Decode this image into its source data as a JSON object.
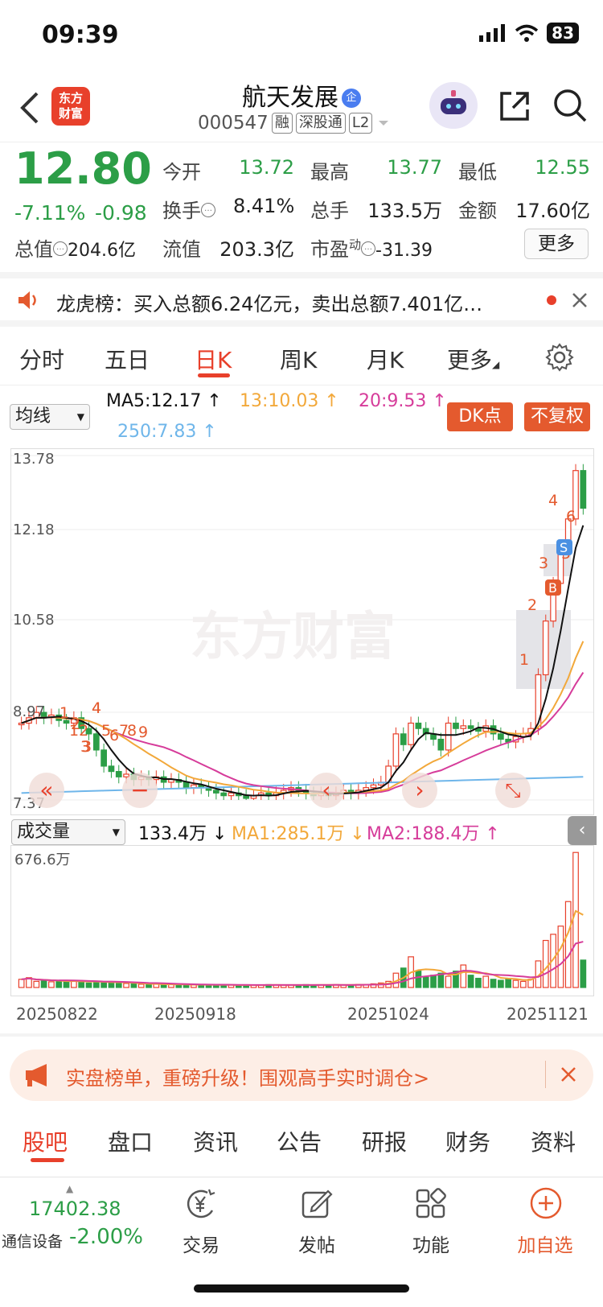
{
  "status_bar": {
    "time": "09:39",
    "battery": "83"
  },
  "header": {
    "logo_line1": "东方",
    "logo_line2": "财富",
    "stock_name": "航天发展",
    "badge": "企",
    "code": "000547",
    "tags": [
      "融",
      "深股通",
      "L2"
    ]
  },
  "quote": {
    "price": "12.80",
    "change_pct": "-7.11%",
    "change_amt": "-0.98",
    "open_label": "今开",
    "open": "13.72",
    "high_label": "最高",
    "high": "13.77",
    "low_label": "最低",
    "low": "12.55",
    "turnover_label": "换手",
    "turnover": "8.41%",
    "volume_label": "总手",
    "volume": "133.5万",
    "amount_label": "金额",
    "amount": "17.60亿",
    "mktcap_label": "总值",
    "mktcap": "204.6亿",
    "float_label": "流值",
    "float": "203.3亿",
    "pe_label": "市盈",
    "pe_sup": "动",
    "pe": "-31.39",
    "more": "更多"
  },
  "notice": {
    "text": "龙虎榜：买入总额6.24亿元，卖出总额7.401亿…"
  },
  "kline_tabs": [
    "分时",
    "五日",
    "日K",
    "周K",
    "月K",
    "更多",
    ""
  ],
  "active_tab": "日K",
  "ma_row": {
    "dropdown": "均线",
    "ma5": "MA5:12.17",
    "ma13": "13:10.03",
    "ma20": "20:9.53",
    "ma250": "250:7.83",
    "dk_button": "DK点",
    "fq_button": "不复权"
  },
  "colors": {
    "up": "#e8402b",
    "down": "#2c9e47",
    "ma5": "#111111",
    "ma13": "#f2a83a",
    "ma20": "#d63c9a",
    "ma250": "#6fb6ea"
  },
  "chart_data": [
    {
      "type": "candlestick",
      "y_ticks": [
        "13.78",
        "12.18",
        "10.58",
        "8.97",
        "7.37"
      ],
      "ylim": [
        7.37,
        13.78
      ],
      "watermark": "东方财富",
      "signals": [
        "1",
        "2",
        "3",
        "4",
        "5",
        "6",
        "7",
        "8",
        "9",
        "12",
        "3",
        "4",
        "1",
        "2",
        "3",
        "4",
        "5",
        "6"
      ],
      "markers": [
        "B",
        "S"
      ],
      "close": [
        8.8,
        8.9,
        9.0,
        8.9,
        8.95,
        8.85,
        8.8,
        8.9,
        8.7,
        8.6,
        8.3,
        8.0,
        7.9,
        7.8,
        7.85,
        7.75,
        7.8,
        7.75,
        7.8,
        7.7,
        7.75,
        7.7,
        7.6,
        7.65,
        7.6,
        7.55,
        7.5,
        7.45,
        7.5,
        7.45,
        7.4,
        7.45,
        7.5,
        7.45,
        7.5,
        7.55,
        7.6,
        7.55,
        7.5,
        7.45,
        7.5,
        7.45,
        7.5,
        7.55,
        7.5,
        7.55,
        7.6,
        7.65,
        7.7,
        8.0,
        8.6,
        8.4,
        8.8,
        8.7,
        8.6,
        8.5,
        8.3,
        8.8,
        8.7,
        8.75,
        8.7,
        8.65,
        8.75,
        8.6,
        8.5,
        8.45,
        8.55,
        8.6,
        8.7,
        9.7,
        10.7,
        11.4,
        12.1,
        12.6,
        13.5,
        12.8
      ]
    },
    {
      "type": "bar",
      "title": "成交量",
      "current": "133.4万",
      "ma1": "MA1:285.1万",
      "ma2": "MA2:188.4万",
      "y_max_label": "676.6万",
      "x_ticks": [
        "20250822",
        "20250918",
        "20251024",
        "20251121"
      ],
      "values": [
        40,
        48,
        30,
        32,
        28,
        30,
        35,
        32,
        25,
        22,
        30,
        28,
        26,
        22,
        20,
        18,
        16,
        15,
        18,
        14,
        14,
        15,
        13,
        12,
        14,
        12,
        13,
        12,
        12,
        11,
        12,
        12,
        13,
        14,
        12,
        11,
        12,
        12,
        14,
        13,
        12,
        12,
        14,
        13,
        12,
        15,
        14,
        18,
        22,
        30,
        70,
        95,
        150,
        80,
        50,
        60,
        70,
        55,
        80,
        110,
        60,
        45,
        55,
        40,
        35,
        45,
        35,
        30,
        40,
        130,
        230,
        260,
        300,
        420,
        660,
        134
      ]
    }
  ],
  "banner": {
    "text": "实盘榜单，重磅升级！围观高手实时调仓>"
  },
  "bottom_tabs": [
    "股吧",
    "盘口",
    "资讯",
    "公告",
    "研报",
    "财务",
    "资料"
  ],
  "bottom_bar": {
    "index_value": "17402.38",
    "index_name": "通信设备",
    "index_change": "-2.00%",
    "items": [
      "交易",
      "发帖",
      "功能",
      "加自选"
    ]
  }
}
